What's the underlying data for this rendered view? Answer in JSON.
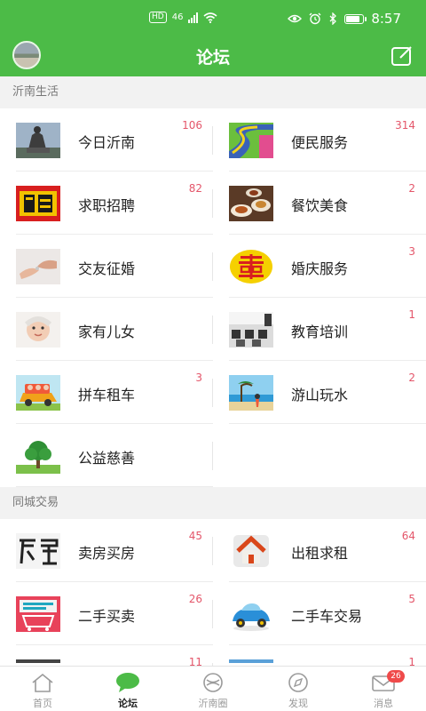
{
  "status_bar": {
    "hd": "HD",
    "signal": "46",
    "time": "8:57",
    "battery_level": 0.85
  },
  "header": {
    "title": "论坛",
    "compose_icon": "compose-icon",
    "avatar": "user-avatar"
  },
  "sections": [
    {
      "title": "沂南生活",
      "items": [
        {
          "label": "今日沂南",
          "count": "106",
          "icon": "statue-thumbnail"
        },
        {
          "label": "便民服务",
          "count": "314",
          "icon": "road-thumbnail"
        },
        {
          "label": "求职招聘",
          "count": "82",
          "icon": "hire-thumbnail"
        },
        {
          "label": "餐饮美食",
          "count": "2",
          "icon": "food-thumbnail"
        },
        {
          "label": "交友征婚",
          "count": "",
          "icon": "hands-thumbnail"
        },
        {
          "label": "婚庆服务",
          "count": "3",
          "icon": "double-happiness-thumbnail"
        },
        {
          "label": "家有儿女",
          "count": "",
          "icon": "baby-thumbnail"
        },
        {
          "label": "教育培训",
          "count": "1",
          "icon": "classroom-thumbnail"
        },
        {
          "label": "拼车租车",
          "count": "3",
          "icon": "carpool-thumbnail"
        },
        {
          "label": "游山玩水",
          "count": "2",
          "icon": "beach-thumbnail"
        },
        {
          "label": "公益慈善",
          "count": "",
          "icon": "tree-thumbnail"
        }
      ]
    },
    {
      "title": "同城交易",
      "items": [
        {
          "label": "卖房买房",
          "count": "45",
          "icon": "fangwu-thumbnail"
        },
        {
          "label": "出租求租",
          "count": "64",
          "icon": "house-thumbnail"
        },
        {
          "label": "二手买卖",
          "count": "26",
          "icon": "cart-thumbnail"
        },
        {
          "label": "二手车交易",
          "count": "5",
          "icon": "toy-car-thumbnail"
        },
        {
          "label": "",
          "count": "11",
          "icon": "partial-thumbnail"
        },
        {
          "label": "",
          "count": "1",
          "icon": "partial-thumbnail"
        }
      ]
    }
  ],
  "tabs": [
    {
      "label": "首页",
      "icon": "home-icon",
      "active": false
    },
    {
      "label": "论坛",
      "icon": "chat-bubble-icon",
      "active": true
    },
    {
      "label": "沂南圈",
      "icon": "compass-icon",
      "active": false
    },
    {
      "label": "发现",
      "icon": "discover-icon",
      "active": false
    },
    {
      "label": "消息",
      "icon": "mail-icon",
      "active": false,
      "badge": "26"
    }
  ],
  "colors": {
    "brand_green": "#4cbb47",
    "count_red": "#e4566a",
    "badge_red": "#ef4a4a"
  }
}
